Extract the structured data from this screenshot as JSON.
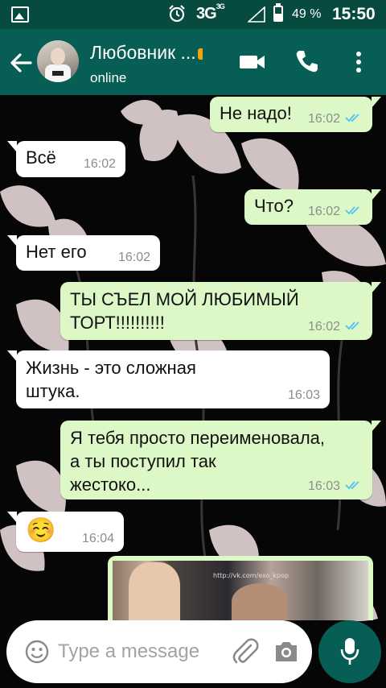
{
  "status_bar": {
    "network": "3G",
    "network_sup": "3G",
    "battery": "49 %",
    "time": "15:50"
  },
  "header": {
    "contact_name": "Любовник ...",
    "status": "online"
  },
  "messages": [
    {
      "direction": "out",
      "text": "Не надо!",
      "time": "16:02",
      "read": true
    },
    {
      "direction": "in",
      "text": "Всё",
      "time": "16:02"
    },
    {
      "direction": "out",
      "text": "Что?",
      "time": "16:02",
      "read": true
    },
    {
      "direction": "in",
      "text": "Нет его",
      "time": "16:02"
    },
    {
      "direction": "out",
      "lines": [
        "ТЫ СЪЕЛ МОЙ ЛЮБИМЫЙ",
        "ТОРТ!!!!!!!!!!"
      ],
      "time": "16:02",
      "read": true
    },
    {
      "direction": "in",
      "lines": [
        "Жизнь - это сложная",
        "штука."
      ],
      "time": "16:03"
    },
    {
      "direction": "out",
      "lines": [
        "Я тебя просто переименовала,",
        "а ты поступил так",
        "жестоко..."
      ],
      "time": "16:03",
      "read": true
    },
    {
      "direction": "in",
      "text": "☺️",
      "time": "16:04"
    },
    {
      "direction": "out",
      "type": "image",
      "watermark": "http://vk.com/exo_kpop"
    }
  ],
  "composer": {
    "placeholder": "Type a message"
  },
  "icons": {
    "status": [
      "gallery-icon",
      "alarm-icon",
      "signal-icon",
      "battery-icon"
    ],
    "header": [
      "back-arrow-icon",
      "video-call-icon",
      "phone-icon",
      "more-vert-icon"
    ],
    "composer": [
      "emoji-icon",
      "attach-icon",
      "camera-icon",
      "mic-icon"
    ]
  },
  "colors": {
    "header": "#075e54",
    "status_bar": "#074a40",
    "outgoing_bubble": "#dcf8c6",
    "incoming_bubble": "#ffffff",
    "read_ticks": "#4fc3f7"
  }
}
